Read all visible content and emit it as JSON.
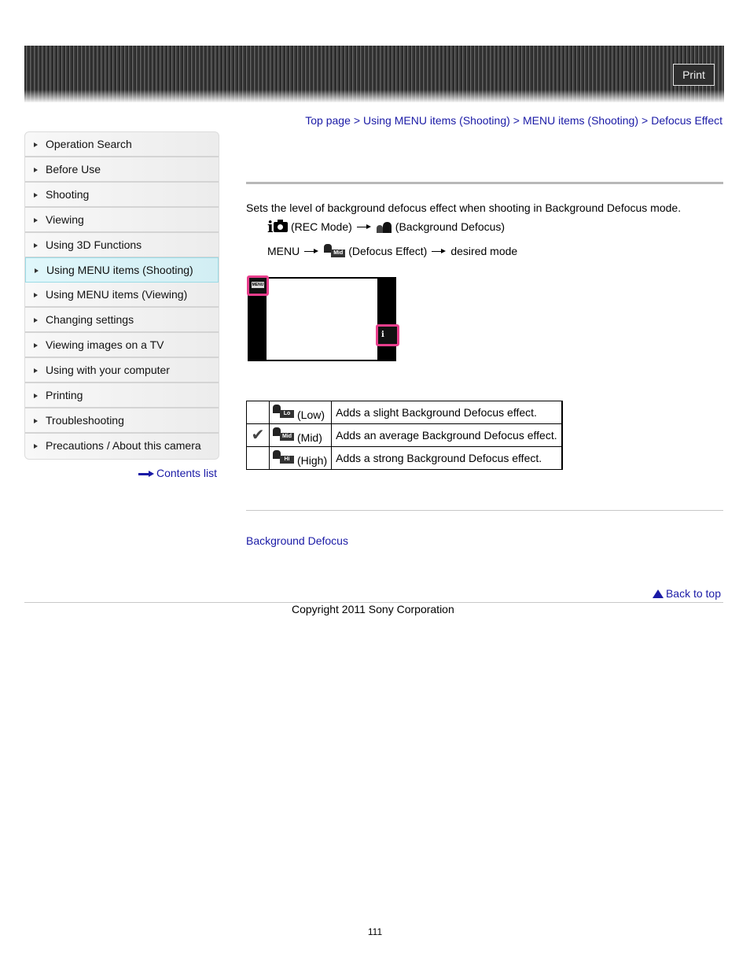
{
  "header": {
    "print_label": "Print"
  },
  "breadcrumb": {
    "items": [
      "Top page",
      "Using MENU items (Shooting)",
      "MENU items (Shooting)",
      "Defocus Effect"
    ],
    "separator": ">"
  },
  "sidebar": {
    "items": [
      {
        "label": "Operation Search",
        "active": false
      },
      {
        "label": "Before Use",
        "active": false
      },
      {
        "label": "Shooting",
        "active": false
      },
      {
        "label": "Viewing",
        "active": false
      },
      {
        "label": "Using 3D Functions",
        "active": false
      },
      {
        "label": "Using MENU items (Shooting)",
        "active": true
      },
      {
        "label": "Using MENU items (Viewing)",
        "active": false
      },
      {
        "label": "Changing settings",
        "active": false
      },
      {
        "label": "Viewing images on a TV",
        "active": false
      },
      {
        "label": "Using with your computer",
        "active": false
      },
      {
        "label": "Printing",
        "active": false
      },
      {
        "label": "Troubleshooting",
        "active": false
      },
      {
        "label": "Precautions / About this camera",
        "active": false
      }
    ],
    "contents_link": "Contents list"
  },
  "main": {
    "intro": "Sets the level of background defocus effect when shooting in Background Defocus mode.",
    "step1": {
      "icon1": "ia-camera-icon",
      "label1": "(REC Mode)",
      "icon2": "background-defocus-icon",
      "label2": "(Background Defocus)"
    },
    "step2": {
      "menu_label": "MENU",
      "icon_badge": "Mid",
      "label1": "(Defocus Effect)",
      "label2": "desired mode"
    },
    "figure": {
      "menu_button_label": "MENU",
      "rec_button_label": "i"
    },
    "modes": [
      {
        "checked": false,
        "badge": "Lo",
        "name": "(Low)",
        "description": "Adds a slight Background Defocus effect."
      },
      {
        "checked": true,
        "badge": "Mid",
        "name": "(Mid)",
        "description": "Adds an average Background Defocus effect."
      },
      {
        "checked": false,
        "badge": "Hi",
        "name": "(High)",
        "description": "Adds a strong Background Defocus effect."
      }
    ],
    "related_link": "Background Defocus",
    "back_to_top": "Back to top"
  },
  "footer": {
    "copyright": "Copyright 2011 Sony Corporation",
    "page_number": "111"
  }
}
